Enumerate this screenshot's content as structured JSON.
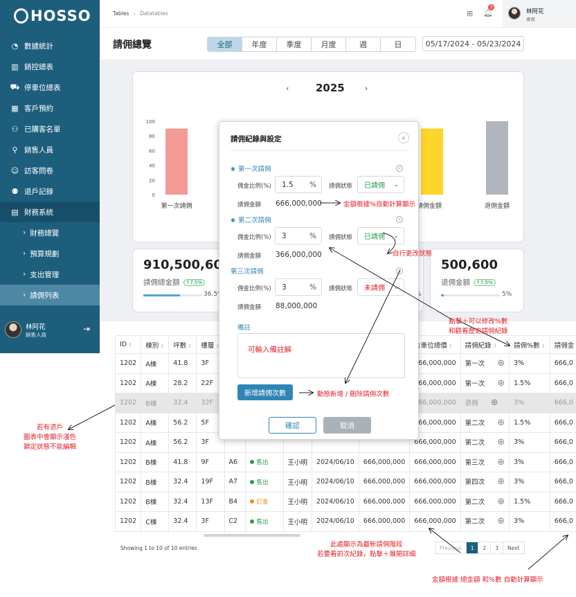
{
  "brand": {
    "logo": "HOSSO"
  },
  "sidebar": {
    "items": [
      {
        "label": "數據統計",
        "icon": "pie-chart-icon"
      },
      {
        "label": "銷控總表",
        "icon": "chart-board-icon"
      },
      {
        "label": "停車位總表",
        "icon": "car-icon"
      },
      {
        "label": "客戶預約",
        "icon": "calendar-icon"
      },
      {
        "label": "已購客名單",
        "icon": "person-check-icon"
      },
      {
        "label": "銷售人員",
        "icon": "person-icon"
      },
      {
        "label": "訪客問卷",
        "icon": "smile-icon"
      },
      {
        "label": "退戶記錄",
        "icon": "person-x-icon"
      },
      {
        "label": "財務系統",
        "icon": "document-icon"
      }
    ],
    "subitems": [
      {
        "label": "財務總覽"
      },
      {
        "label": "預算規劃"
      },
      {
        "label": "支出管理"
      },
      {
        "label": "請佣列表"
      }
    ],
    "user": {
      "name": "林阿花",
      "role": "銷售人員"
    }
  },
  "topbar": {
    "breadcrumb": [
      "Tables",
      "Datatables"
    ],
    "notif_count": "3",
    "user_name": "林阿花",
    "user_role": "專員"
  },
  "page": {
    "title": "請佣總覽",
    "tabs": [
      "全部",
      "年度",
      "季度",
      "月度",
      "週",
      "日"
    ],
    "active_tab": 0,
    "date_range": "05/17/2024 - 05/23/2024"
  },
  "chart_data": {
    "type": "bar",
    "year": "2025",
    "ylim": [
      0,
      100
    ],
    "y_ticks": [
      "100",
      "80",
      "60",
      "40",
      "20",
      "0"
    ],
    "categories": [
      "第一次請佣",
      "第二次請佣",
      "第三次請佣",
      "請佣總金額",
      "退佣金額"
    ],
    "visible_labels": [
      "第一次請佣",
      "請佣金額",
      "退佣金額"
    ],
    "values": [
      90,
      0,
      0,
      90,
      100
    ],
    "colors": [
      "#f49a95",
      "#cccccc",
      "#cccccc",
      "#fdd42a",
      "#b1b6be"
    ]
  },
  "stats": [
    {
      "value": "910,500,600",
      "label": "請佣總金額",
      "badge": "↑7.5%",
      "pct": "36.5%",
      "fill": 0.62
    },
    {
      "value": "500,600",
      "label": "退佣金額",
      "badge": "↑7.5%",
      "pct": "5%",
      "fill": 0.05
    }
  ],
  "stat_partial_pct": "%",
  "modal": {
    "title": "請佣紀錄與設定",
    "close": "×",
    "records": [
      {
        "title": "第一次請佣",
        "ratio_label": "佣金比例(%)",
        "ratio": "1.5",
        "unit": "%",
        "status_label": "請佣狀態",
        "status": "已請佣",
        "amount_label": "請佣金額",
        "amount": "666,000,000"
      },
      {
        "title": "第二次請佣",
        "ratio_label": "佣金比例(%)",
        "ratio": "3",
        "unit": "%",
        "status_label": "請佣狀態",
        "status": "已請佣",
        "amount_label": "請佣金額",
        "amount": "366,000,000"
      },
      {
        "title": "第三次請佣",
        "ratio_label": "佣金比例(%)",
        "ratio": "3",
        "unit": "%",
        "status_label": "請佣狀態",
        "status": "未請佣",
        "amount_label": "請佣金額",
        "amount": "88,000,000"
      }
    ],
    "note_label": "備註",
    "note_placeholder": "可輸入備註解",
    "add_button": "新增請佣次數",
    "confirm": "確認",
    "cancel": "取消"
  },
  "table": {
    "headers": [
      "ID",
      "棟別",
      "坪數",
      "樓層",
      "",
      "",
      "",
      "",
      "",
      "含車位總價",
      "請佣紀錄",
      "請佣%數",
      "請佣金"
    ],
    "rows": [
      {
        "id": "1202",
        "building": "A棟",
        "area": "41.8",
        "floor": "3F",
        "unit": "",
        "status": "",
        "status_color": "",
        "agent": "",
        "date": "",
        "price": "",
        "total": "666,000,000",
        "record": "第一次",
        "pct": "3%",
        "comm": "666,0"
      },
      {
        "id": "1202",
        "building": "A棟",
        "area": "28.2",
        "floor": "22F",
        "unit": "",
        "status": "",
        "status_color": "",
        "agent": "",
        "date": "",
        "price": "",
        "total": "666,000,000",
        "record": "第一次",
        "pct": "1.5%",
        "comm": "666,0"
      },
      {
        "id": "1202",
        "building": "B棟",
        "area": "32.4",
        "floor": "32F",
        "unit": "",
        "status": "",
        "status_color": "",
        "agent": "",
        "date": "",
        "price": "",
        "total": "666,000,000",
        "record": "退佣",
        "pct": "3%",
        "comm": "666,0",
        "grey": true
      },
      {
        "id": "1202",
        "building": "A棟",
        "area": "56.2",
        "floor": "5F",
        "unit": "",
        "status": "",
        "status_color": "",
        "agent": "",
        "date": "",
        "price": "",
        "total": "666,000,000",
        "record": "第二次",
        "pct": "1.5%",
        "comm": "666,0"
      },
      {
        "id": "1202",
        "building": "A棟",
        "area": "56.2",
        "floor": "3F",
        "unit": "",
        "status": "",
        "status_color": "",
        "agent": "",
        "date": "",
        "price": "",
        "total": "666,000,000",
        "record": "第二次",
        "pct": "3%",
        "comm": "666,0"
      },
      {
        "id": "1202",
        "building": "B棟",
        "area": "41.8",
        "floor": "9F",
        "unit": "A6",
        "status": "售出",
        "status_color": "#2a9b4e",
        "agent": "王小明",
        "date": "2024/06/10",
        "price": "666,000,000",
        "total": "666,000,000",
        "record": "第三次",
        "pct": "3%",
        "comm": "666,0"
      },
      {
        "id": "1202",
        "building": "B棟",
        "area": "32.4",
        "floor": "19F",
        "unit": "A7",
        "status": "售出",
        "status_color": "#2a9b4e",
        "agent": "王小明",
        "date": "2024/06/10",
        "price": "666,000,000",
        "total": "666,000,000",
        "record": "第四次",
        "pct": "3%",
        "comm": "666,0"
      },
      {
        "id": "1202",
        "building": "B棟",
        "area": "32.4",
        "floor": "13F",
        "unit": "B4",
        "status": "訂金",
        "status_color": "#f08c1a",
        "agent": "王小明",
        "date": "2024/06/10",
        "price": "666,000,000",
        "total": "666,000,000",
        "record": "第二次",
        "pct": "1.5%",
        "comm": "666,0"
      },
      {
        "id": "1202",
        "building": "C棟",
        "area": "32.4",
        "floor": "3F",
        "unit": "C2",
        "status": "售出",
        "status_color": "#2a9b4e",
        "agent": "王小明",
        "date": "2024/06/10",
        "price": "666,000,000",
        "total": "666,000,000",
        "record": "第二次",
        "pct": "3%",
        "comm": "666,0"
      }
    ],
    "footer": "Showing 1 to 10 of 10 entries",
    "pagination": [
      "Previous",
      "1",
      "2",
      "3",
      "Next"
    ]
  },
  "annotations": {
    "a1": "金額根據%自動計算顯示",
    "a2": "自行更改狀態",
    "a3": "點擊＋可以修改%數",
    "a3b": "和觀看歷史請佣紀錄",
    "a4": "動態新增 / 刪除請佣次數",
    "a5": "若有退戶",
    "a5b": "圖表中會顯示淺色",
    "a5c": "鎖定狀態不能編輯",
    "a6": "此處顯示為最新請佣階段",
    "a6b": "若要看前次紀錄，點擊＋展開詳細",
    "a7": "金額根據 總金額 和%數 自動計算顯示"
  },
  "colors": {
    "sidebar": "#1d5e7d",
    "accent": "#3a9bd0",
    "red": "#e3222a"
  }
}
